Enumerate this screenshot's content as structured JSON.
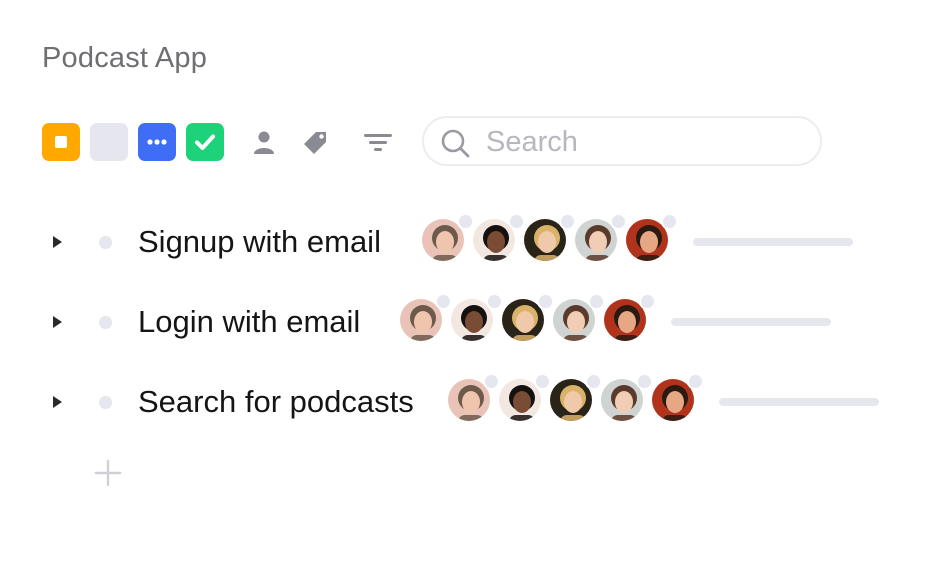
{
  "app": {
    "title": "Podcast App"
  },
  "toolbar": {
    "status_filters": [
      {
        "name": "todo",
        "color": "#ffa800"
      },
      {
        "name": "open",
        "color": "#e6e6ef"
      },
      {
        "name": "in-progress",
        "color": "#3f6df6"
      },
      {
        "name": "done",
        "color": "#1ed27a"
      }
    ],
    "icons": [
      "user-icon",
      "tag-icon",
      "filter-icon"
    ],
    "search": {
      "placeholder": "Search",
      "value": ""
    }
  },
  "tasks": [
    {
      "label": "Signup with email",
      "progress": 0
    },
    {
      "label": "Login with email",
      "progress": 0
    },
    {
      "label": "Search for podcasts",
      "progress": 0
    }
  ],
  "avatars": [
    {
      "name": "avatar-1",
      "bg": "#e9c3b8",
      "hair": "#6e5a4b",
      "skin": "#f0c5ae"
    },
    {
      "name": "avatar-2",
      "bg": "#f3e7e1",
      "hair": "#151110",
      "skin": "#7a4b35"
    },
    {
      "name": "avatar-3",
      "bg": "#2a2418",
      "hair": "#d9b36a",
      "skin": "#efc9a9"
    },
    {
      "name": "avatar-4",
      "bg": "#cfd3d1",
      "hair": "#5a3a2a",
      "skin": "#f1cdb5"
    },
    {
      "name": "avatar-5",
      "bg": "#b0331b",
      "hair": "#2a1a12",
      "skin": "#e6a884"
    }
  ],
  "colors": {
    "accent": "#3f6df6",
    "track": "#e6e6ef",
    "text": "#151515",
    "muted": "#6e6e73"
  }
}
